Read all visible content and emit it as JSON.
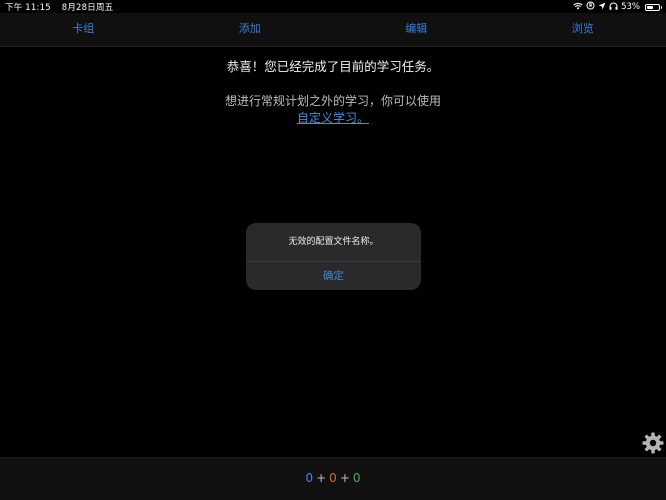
{
  "status_bar": {
    "time": "下午 11:15",
    "date": "8月28日周五",
    "battery": "53%",
    "battery_level": 0.53
  },
  "tabs": [
    {
      "label": "卡组"
    },
    {
      "label": "添加"
    },
    {
      "label": "编辑"
    },
    {
      "label": "浏览"
    }
  ],
  "main": {
    "congrats": "恭喜！您已经完成了目前的学习任务。",
    "hint": "想进行常规计划之外的学习，你可以使用",
    "custom_study_link": "自定义学习。"
  },
  "alert": {
    "message": "无效的配置文件名称。",
    "button": "确定"
  },
  "counts": {
    "new": "0",
    "learning": "0",
    "review": "0",
    "plus": "+"
  },
  "colors": {
    "accent": "#3a7fd6",
    "new": "#4a86d8",
    "learning": "#d2662e",
    "review": "#4caf50"
  }
}
